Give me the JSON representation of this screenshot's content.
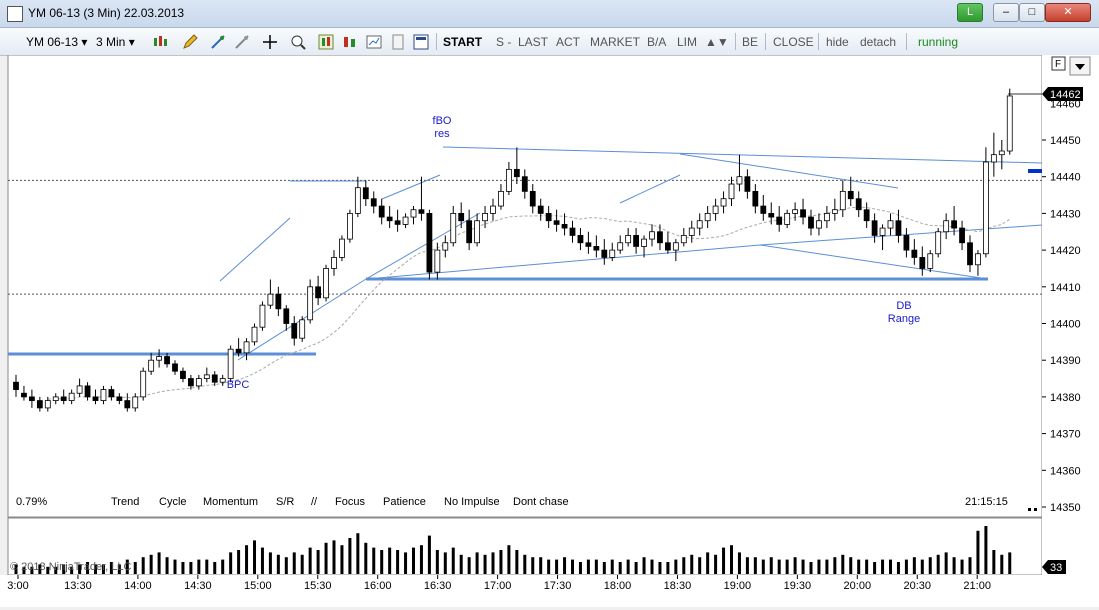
{
  "window": {
    "title": "YM 06-13 (3 Min)  22.03.2013",
    "l_button": "L",
    "min_glyph": "–",
    "max_glyph": "□",
    "close_glyph": "✕"
  },
  "toolbar": {
    "instrument": "YM 06-13",
    "interval": "3 Min",
    "start": "START",
    "s": "S -",
    "last": "LAST",
    "act": "ACT",
    "market": "MARKET",
    "ba": "B/A",
    "lim": "LIM",
    "arrows": "▲▼",
    "be": "BE",
    "close": "CLOSE",
    "hide": "hide",
    "detach": "detach",
    "status": "running"
  },
  "chart_data": {
    "type": "candlestick",
    "price_axis": {
      "ticks": [
        "14450",
        "14440",
        "14430",
        "14420",
        "14410",
        "14400",
        "14390",
        "14380",
        "14370",
        "14360",
        "14350"
      ],
      "top_label": "14460",
      "last_price": "14462"
    },
    "time_axis": {
      "ticks": [
        "3:00",
        "13:30",
        "14:00",
        "14:30",
        "15:00",
        "15:30",
        "16:00",
        "16:30",
        "17:00",
        "17:30",
        "18:00",
        "18:30",
        "19:00",
        "19:30",
        "20:00",
        "20:30",
        "21:00"
      ]
    },
    "volume_label": "33",
    "f_button": "F",
    "annotations": [
      {
        "text": "fBO"
      },
      {
        "text": "res"
      },
      {
        "text": "BPC"
      },
      {
        "text": "DB"
      },
      {
        "text": "Range"
      }
    ],
    "footer_labels": [
      "Trend",
      "Cycle",
      "Momentum",
      "S/R",
      "//",
      "Focus",
      "Patience",
      "No Impulse",
      "Dont chase"
    ],
    "percent": "0.79%",
    "clock": "21:15:15",
    "copyright": "© 2013 NinjaTrader, LLC",
    "ohlc": [
      [
        14384,
        14386,
        14380,
        14382
      ],
      [
        14381,
        14383,
        14379,
        14380
      ],
      [
        14380,
        14382,
        14377,
        14379
      ],
      [
        14379,
        14380,
        14376,
        14377
      ],
      [
        14377,
        14380,
        14376,
        14379
      ],
      [
        14379,
        14381,
        14378,
        14380
      ],
      [
        14380,
        14382,
        14378,
        14379
      ],
      [
        14379,
        14382,
        14378,
        14381
      ],
      [
        14381,
        14385,
        14380,
        14383
      ],
      [
        14383,
        14384,
        14379,
        14380
      ],
      [
        14380,
        14382,
        14378,
        14379
      ],
      [
        14379,
        14383,
        14378,
        14382
      ],
      [
        14382,
        14383,
        14379,
        14380
      ],
      [
        14380,
        14381,
        14378,
        14379
      ],
      [
        14379,
        14381,
        14376,
        14377
      ],
      [
        14377,
        14381,
        14376,
        14380
      ],
      [
        14380,
        14388,
        14379,
        14387
      ],
      [
        14387,
        14392,
        14386,
        14390
      ],
      [
        14390,
        14393,
        14388,
        14391
      ],
      [
        14391,
        14392,
        14388,
        14389
      ],
      [
        14389,
        14390,
        14386,
        14387
      ],
      [
        14387,
        14388,
        14384,
        14385
      ],
      [
        14385,
        14386,
        14382,
        14383
      ],
      [
        14383,
        14386,
        14382,
        14385
      ],
      [
        14385,
        14388,
        14384,
        14386
      ],
      [
        14386,
        14387,
        14383,
        14384
      ],
      [
        14384,
        14386,
        14383,
        14385
      ],
      [
        14385,
        14394,
        14384,
        14393
      ],
      [
        14393,
        14396,
        14391,
        14392
      ],
      [
        14392,
        14396,
        14390,
        14395
      ],
      [
        14395,
        14400,
        14394,
        14399
      ],
      [
        14399,
        14406,
        14398,
        14405
      ],
      [
        14405,
        14412,
        14404,
        14408
      ],
      [
        14408,
        14410,
        14402,
        14404
      ],
      [
        14404,
        14405,
        14398,
        14400
      ],
      [
        14400,
        14402,
        14394,
        14396
      ],
      [
        14396,
        14402,
        14395,
        14401
      ],
      [
        14401,
        14412,
        14400,
        14410
      ],
      [
        14410,
        14413,
        14405,
        14407
      ],
      [
        14407,
        14416,
        14406,
        14415
      ],
      [
        14415,
        14420,
        14413,
        14418
      ],
      [
        14418,
        14424,
        14417,
        14423
      ],
      [
        14423,
        14431,
        14422,
        14430
      ],
      [
        14430,
        14440,
        14429,
        14437
      ],
      [
        14437,
        14439,
        14432,
        14434
      ],
      [
        14434,
        14436,
        14430,
        14432
      ],
      [
        14432,
        14434,
        14427,
        14429
      ],
      [
        14429,
        14432,
        14426,
        14428
      ],
      [
        14428,
        14431,
        14425,
        14427
      ],
      [
        14427,
        14430,
        14426,
        14429
      ],
      [
        14429,
        14432,
        14427,
        14431
      ],
      [
        14431,
        14440,
        14428,
        14430
      ],
      [
        14430,
        14431,
        14412,
        14414
      ],
      [
        14414,
        14422,
        14412,
        14420
      ],
      [
        14420,
        14424,
        14418,
        14422
      ],
      [
        14422,
        14432,
        14421,
        14430
      ],
      [
        14430,
        14433,
        14426,
        14428
      ],
      [
        14428,
        14431,
        14420,
        14422
      ],
      [
        14422,
        14430,
        14421,
        14428
      ],
      [
        14428,
        14432,
        14426,
        14430
      ],
      [
        14430,
        14434,
        14428,
        14432
      ],
      [
        14432,
        14438,
        14431,
        14436
      ],
      [
        14436,
        14444,
        14435,
        14442
      ],
      [
        14442,
        14448,
        14438,
        14440
      ],
      [
        14440,
        14442,
        14434,
        14436
      ],
      [
        14436,
        14438,
        14430,
        14432
      ],
      [
        14432,
        14434,
        14428,
        14430
      ],
      [
        14430,
        14432,
        14426,
        14428
      ],
      [
        14428,
        14431,
        14425,
        14427
      ],
      [
        14427,
        14430,
        14424,
        14426
      ],
      [
        14426,
        14428,
        14422,
        14424
      ],
      [
        14424,
        14426,
        14420,
        14422
      ],
      [
        14422,
        14425,
        14419,
        14421
      ],
      [
        14421,
        14424,
        14418,
        14420
      ],
      [
        14420,
        14423,
        14416,
        14418
      ],
      [
        14418,
        14422,
        14417,
        14420
      ],
      [
        14420,
        14424,
        14419,
        14422
      ],
      [
        14422,
        14426,
        14421,
        14424
      ],
      [
        14424,
        14426,
        14419,
        14421
      ],
      [
        14421,
        14424,
        14418,
        14423
      ],
      [
        14423,
        14427,
        14421,
        14425
      ],
      [
        14425,
        14427,
        14420,
        14422
      ],
      [
        14422,
        14425,
        14419,
        14420
      ],
      [
        14420,
        14423,
        14417,
        14422
      ],
      [
        14422,
        14426,
        14421,
        14424
      ],
      [
        14424,
        14428,
        14422,
        14426
      ],
      [
        14426,
        14430,
        14424,
        14428
      ],
      [
        14428,
        14432,
        14426,
        14430
      ],
      [
        14430,
        14434,
        14428,
        14432
      ],
      [
        14432,
        14436,
        14430,
        14434
      ],
      [
        14434,
        14440,
        14432,
        14438
      ],
      [
        14438,
        14446,
        14436,
        14440
      ],
      [
        14440,
        14442,
        14434,
        14436
      ],
      [
        14436,
        14438,
        14430,
        14432
      ],
      [
        14432,
        14435,
        14428,
        14430
      ],
      [
        14430,
        14433,
        14427,
        14429
      ],
      [
        14429,
        14432,
        14425,
        14427
      ],
      [
        14427,
        14431,
        14426,
        14430
      ],
      [
        14430,
        14433,
        14428,
        14431
      ],
      [
        14431,
        14434,
        14427,
        14429
      ],
      [
        14429,
        14431,
        14424,
        14426
      ],
      [
        14426,
        14430,
        14424,
        14428
      ],
      [
        14428,
        14432,
        14426,
        14430
      ],
      [
        14430,
        14434,
        14428,
        14431
      ],
      [
        14431,
        14439,
        14429,
        14436
      ],
      [
        14436,
        14440,
        14432,
        14434
      ],
      [
        14434,
        14436,
        14429,
        14431
      ],
      [
        14431,
        14433,
        14426,
        14428
      ],
      [
        14428,
        14430,
        14422,
        14424
      ],
      [
        14424,
        14427,
        14420,
        14426
      ],
      [
        14426,
        14430,
        14424,
        14428
      ],
      [
        14428,
        14431,
        14422,
        14424
      ],
      [
        14424,
        14426,
        14418,
        14420
      ],
      [
        14420,
        14423,
        14416,
        14418
      ],
      [
        14418,
        14421,
        14413,
        14415
      ],
      [
        14415,
        14420,
        14414,
        14419
      ],
      [
        14419,
        14426,
        14418,
        14425
      ],
      [
        14425,
        14430,
        14423,
        14428
      ],
      [
        14428,
        14432,
        14424,
        14426
      ],
      [
        14426,
        14428,
        14420,
        14422
      ],
      [
        14422,
        14424,
        14414,
        14416
      ],
      [
        14416,
        14420,
        14413,
        14419
      ],
      [
        14419,
        14448,
        14418,
        14444
      ],
      [
        14444,
        14452,
        14440,
        14446
      ],
      [
        14446,
        14450,
        14442,
        14447
      ],
      [
        14447,
        14464,
        14446,
        14462
      ]
    ],
    "volume": [
      4,
      3,
      3,
      4,
      3,
      3,
      4,
      3,
      4,
      5,
      4,
      4,
      5,
      4,
      6,
      5,
      7,
      8,
      9,
      7,
      6,
      5,
      5,
      6,
      6,
      5,
      6,
      9,
      10,
      12,
      14,
      11,
      9,
      8,
      7,
      9,
      8,
      11,
      10,
      13,
      14,
      12,
      15,
      17,
      13,
      11,
      10,
      11,
      10,
      9,
      11,
      12,
      16,
      10,
      9,
      11,
      8,
      7,
      9,
      8,
      9,
      10,
      12,
      10,
      8,
      7,
      7,
      6,
      6,
      7,
      6,
      5,
      6,
      6,
      5,
      6,
      5,
      6,
      5,
      7,
      6,
      5,
      5,
      6,
      7,
      8,
      7,
      9,
      8,
      11,
      12,
      9,
      7,
      7,
      6,
      7,
      6,
      6,
      7,
      6,
      5,
      6,
      6,
      7,
      8,
      7,
      6,
      6,
      5,
      6,
      6,
      5,
      6,
      7,
      6,
      7,
      8,
      9,
      7,
      6,
      7,
      18,
      20,
      10,
      8,
      9
    ]
  }
}
